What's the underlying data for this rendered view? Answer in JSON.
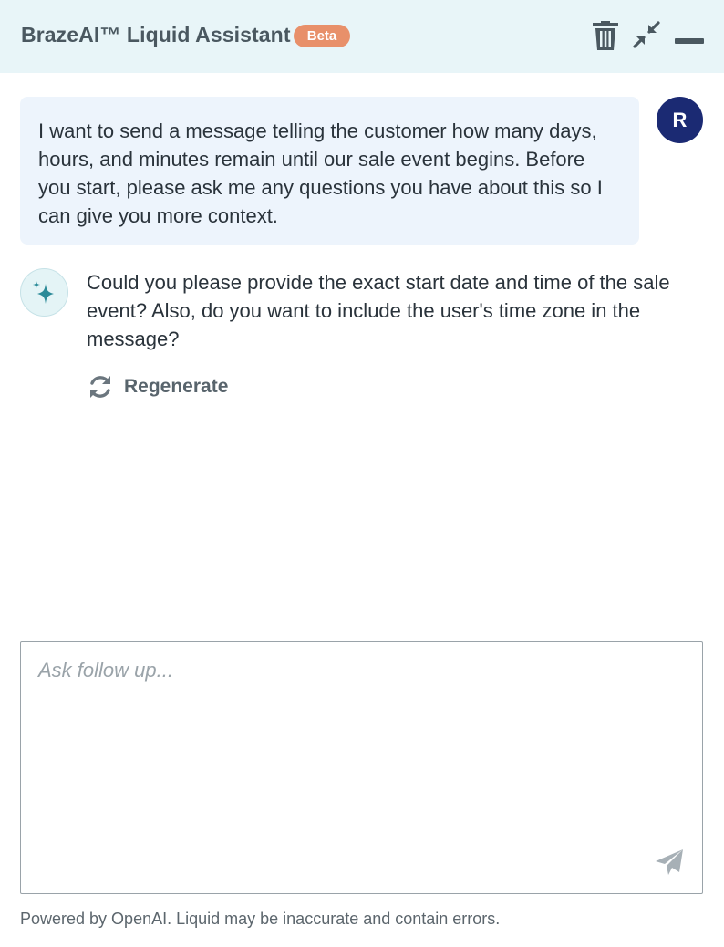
{
  "header": {
    "title": "BrazeAI™ Liquid Assistant",
    "badge": "Beta",
    "icons": [
      "trash-icon",
      "collapse-icon",
      "minimize-icon"
    ]
  },
  "conversation": {
    "user_message": {
      "text": "I want to send a message telling the customer how many days, hours, and minutes remain until our sale event begins. Before you start, please ask me any questions you have about this so I can give you more context.",
      "avatar_initial": "R"
    },
    "assistant_message": {
      "text": "Could you please provide the exact start date and time of the sale event? Also, do you want to include the user's time zone in the message?",
      "icon": "sparkle-icon"
    },
    "regenerate_label": "Regenerate"
  },
  "composer": {
    "placeholder": "Ask follow up...",
    "value": "",
    "send_icon": "send-icon"
  },
  "footer": {
    "disclaimer": "Powered by OpenAI. Liquid may be inaccurate and contain errors."
  },
  "colors": {
    "header_bg": "#e8f5f8",
    "badge_bg": "#e8906a",
    "user_bubble_bg": "#edf4fc",
    "user_avatar_bg": "#1b2a73",
    "ai_icon_color": "#2b8a98"
  }
}
